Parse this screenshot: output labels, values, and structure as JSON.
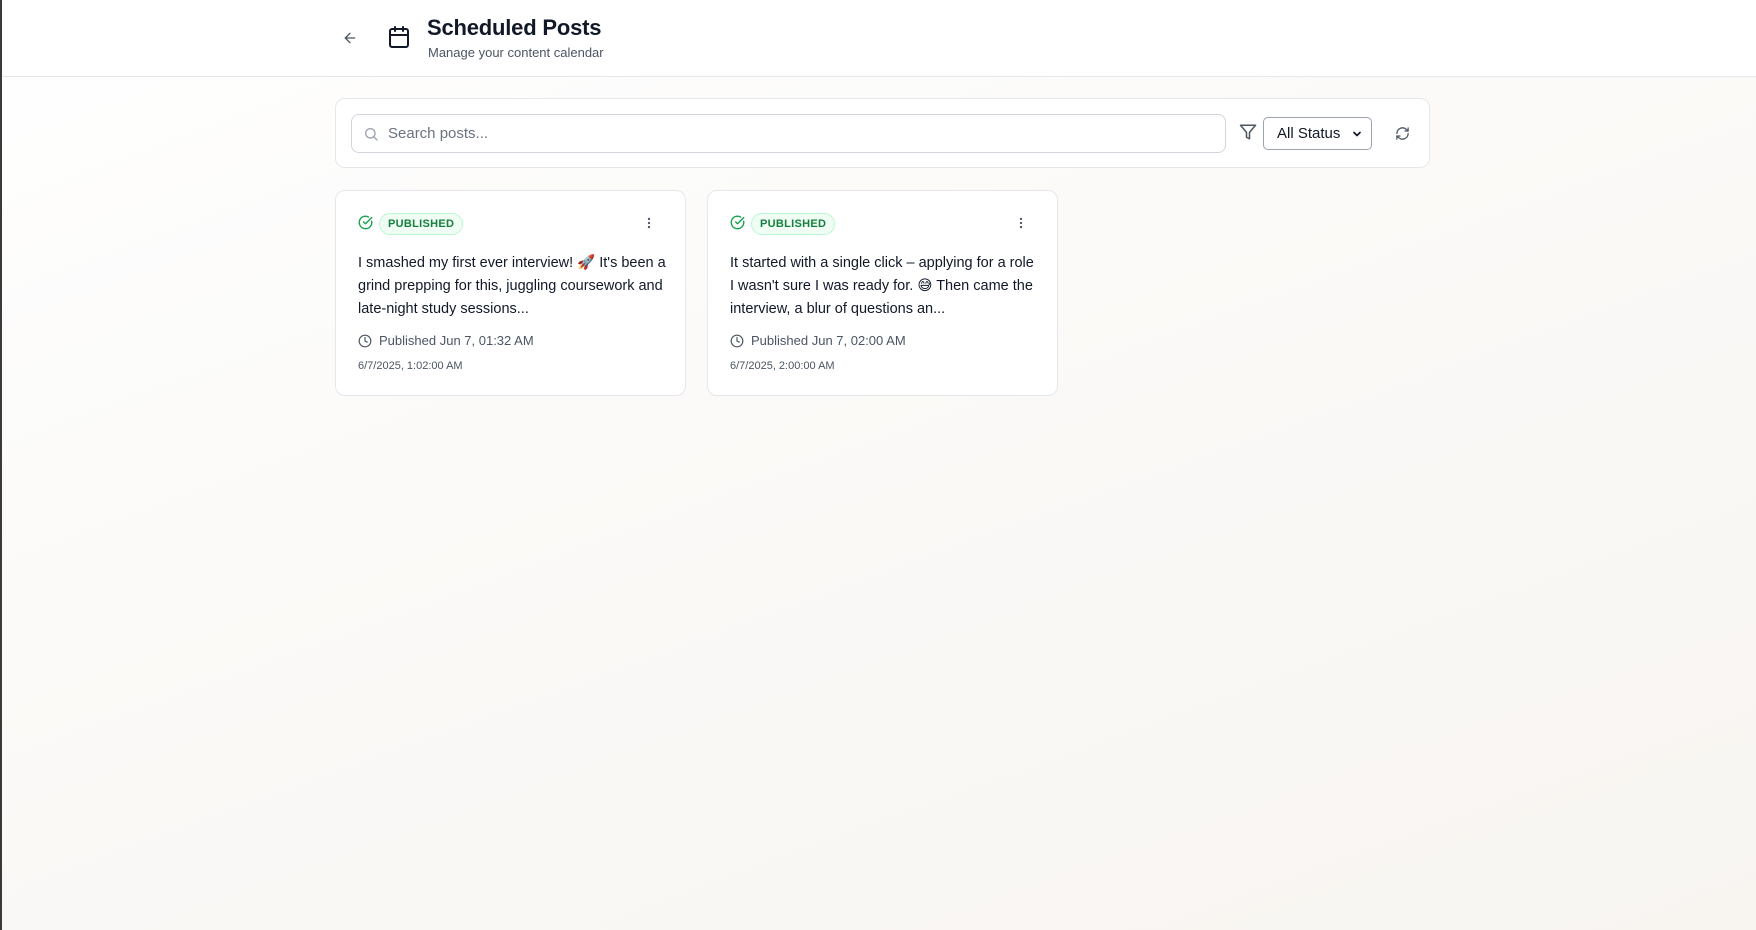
{
  "header": {
    "title": "Scheduled Posts",
    "subtitle": "Manage your content calendar"
  },
  "toolbar": {
    "search_placeholder": "Search posts...",
    "status_filter": "All Status"
  },
  "posts": [
    {
      "status": "PUBLISHED",
      "content": "I smashed my first ever interview! 🚀 It's been a grind prepping for this, juggling coursework and late-night study sessions...",
      "published": "Published Jun 7, 01:32 AM",
      "timestamp": "6/7/2025, 1:02:00 AM"
    },
    {
      "status": "PUBLISHED",
      "content": "It started with a single click – applying for a role I wasn't sure I was ready for. 😅 Then came the interview, a blur of questions an...",
      "published": "Published Jun 7, 02:00 AM",
      "timestamp": "6/7/2025, 2:00:00 AM"
    }
  ],
  "colors": {
    "published_green": "#16a34a",
    "badge_bg": "#f0fdf4",
    "border": "#e5e7eb"
  }
}
